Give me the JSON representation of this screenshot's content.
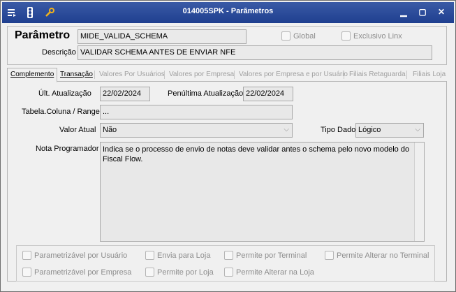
{
  "window": {
    "title": "014005SPK - Parâmetros"
  },
  "header": {
    "parametro_label": "Parâmetro",
    "parametro_value": "MIDE_VALIDA_SCHEMA",
    "descricao_label": "Descrição",
    "descricao_value": "VALIDAR SCHEMA ANTES DE ENVIAR NFE",
    "global_label": "Global",
    "exclusivo_label": "Exclusivo Linx"
  },
  "tabs": [
    {
      "label": "Complemento"
    },
    {
      "label": "Transação"
    },
    {
      "label": "Valores Por Usuários"
    },
    {
      "label": "Valores por Empresa"
    },
    {
      "label": "Valores por Empresa e por Usuário"
    },
    {
      "label": "Filiais Retaguarda"
    },
    {
      "label": "Filiais Loja"
    }
  ],
  "form": {
    "ult_atualizacao_label": "Últ. Atualização",
    "ult_atualizacao_value": "22/02/2024",
    "penultima_label": "Penúltima Atualização",
    "penultima_value": "22/02/2024",
    "tabela_label": "Tabela.Coluna / Range",
    "tabela_value": "...",
    "valor_atual_label": "Valor Atual",
    "valor_atual_value": "Não",
    "tipo_dado_label": "Tipo Dado",
    "tipo_dado_value": "Lógico",
    "nota_label": "Nota Programador",
    "nota_value": "Indica se o processo de envio de notas deve validar antes o schema pelo novo modelo do Fiscal Flow."
  },
  "options": {
    "parametrizavel_usuario": "Parametrizável por Usuário",
    "envia_para_loja": "Envia para Loja",
    "permite_por_terminal": "Permite por Terminal",
    "permite_alterar_terminal": "Permite Alterar no Terminal",
    "parametrizavel_empresa": "Parametrizável por Empresa",
    "permite_por_loja": "Permite por Loja",
    "permite_alterar_loja": "Permite Alterar na Loja"
  },
  "icons": {
    "menu": "window-menu-icon",
    "traffic": "traffic-light-icon",
    "tools": "wrench-icon"
  },
  "colors": {
    "titlebar": "#1f3f8f",
    "field_readonly": "#e8e8e8",
    "disabled_text": "#8c8c8c"
  }
}
